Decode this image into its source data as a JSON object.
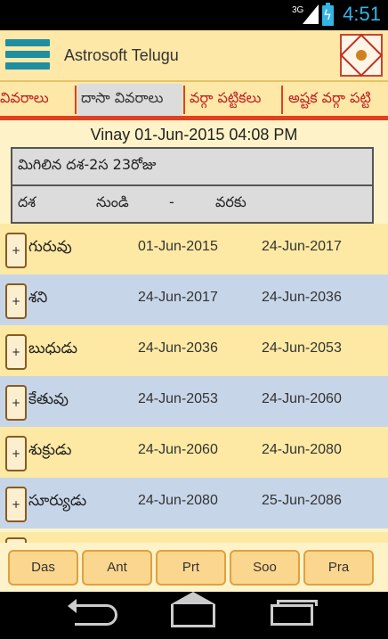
{
  "status_bar": {
    "network": "3G",
    "time": "4:51"
  },
  "app_bar": {
    "title": "Astrosoft Telugu",
    "menu_icon": "hamburger-menu-icon",
    "logo_icon": "astrology-chart-logo"
  },
  "tabs": [
    {
      "label": "వివరాలు",
      "active": false
    },
    {
      "label": "దాసా వివరాలు",
      "active": true
    },
    {
      "label": "వర్గా పట్టికలు",
      "active": false
    },
    {
      "label": "అష్టక వర్గా పట్టి",
      "active": false
    }
  ],
  "header": {
    "text": "Vinay 01-Jun-2015 04:08 PM"
  },
  "remaining": {
    "text": "మిగిలిన దశ-2స 23రోజు"
  },
  "columns": {
    "dasha": "దశ",
    "from": "నుండి",
    "sep": "-",
    "to": "వరకు"
  },
  "rows": [
    {
      "plus": "+",
      "planet": "గురువు",
      "from": "01-Jun-2015",
      "to": "24-Jun-2017"
    },
    {
      "plus": "+",
      "planet": "శని",
      "from": "24-Jun-2017",
      "to": "24-Jun-2036"
    },
    {
      "plus": "+",
      "planet": "బుధుడు",
      "from": "24-Jun-2036",
      "to": "24-Jun-2053"
    },
    {
      "plus": "+",
      "planet": "కేతువు",
      "from": "24-Jun-2053",
      "to": "24-Jun-2060"
    },
    {
      "plus": "+",
      "planet": "శుక్రుడు",
      "from": "24-Jun-2060",
      "to": "24-Jun-2080"
    },
    {
      "plus": "+",
      "planet": "సూర్యుడు",
      "from": "24-Jun-2080",
      "to": "25-Jun-2086"
    }
  ],
  "buttons": {
    "das": "Das",
    "ant": "Ant",
    "prt": "Prt",
    "soo": "Soo",
    "pra": "Pra"
  },
  "colors": {
    "accent": "#e04020",
    "app_bar": "#fde8a8",
    "row_odd": "#fde9a3",
    "row_even": "#c7d5e9",
    "button": "#fbd68f",
    "clock": "#33b5e5"
  }
}
